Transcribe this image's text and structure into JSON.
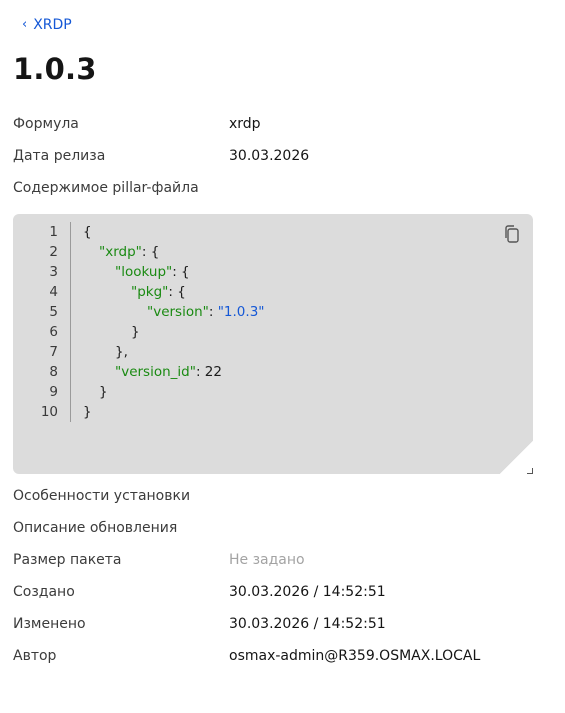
{
  "nav": {
    "back_label": "XRDP"
  },
  "page": {
    "title": "1.0.3"
  },
  "fields": {
    "formula": {
      "label": "Формула",
      "value": "xrdp"
    },
    "release_date": {
      "label": "Дата релиза",
      "value": "30.03.2026"
    },
    "pillar": {
      "label": "Содержимое pillar-файла"
    },
    "install_features": {
      "label": "Особенности установки"
    },
    "update_description": {
      "label": "Описание обновления"
    },
    "package_size": {
      "label": "Размер пакета",
      "value": "Не задано"
    },
    "created": {
      "label": "Создано",
      "value": "30.03.2026 / 14:52:51"
    },
    "modified": {
      "label": "Изменено",
      "value": "30.03.2026 / 14:52:51"
    },
    "author": {
      "label": "Автор",
      "value": "osmax-admin@R359.OSMAX.LOCAL"
    }
  },
  "code": {
    "line_numbers": [
      "1",
      "2",
      "3",
      "4",
      "5",
      "6",
      "7",
      "8",
      "9",
      "10"
    ],
    "tokens": {
      "open_brace": "{",
      "close_brace": "}",
      "close_brace_comma": "},",
      "colon_brace": ": {",
      "colon": ": ",
      "colon_num": ": 22",
      "key_xrdp": "\"xrdp\"",
      "key_lookup": "\"lookup\"",
      "key_pkg": "\"pkg\"",
      "key_version": "\"version\"",
      "val_version": "\"1.0.3\"",
      "key_version_id": "\"version_id\""
    }
  },
  "colors": {
    "link": "#1558d6",
    "json_key": "#1a8a12",
    "json_string": "#1558d6",
    "code_bg": "#dcdcdc",
    "muted": "#a3a3a3"
  },
  "icons": {
    "copy": "copy-icon",
    "back": "chevron-left-icon"
  }
}
